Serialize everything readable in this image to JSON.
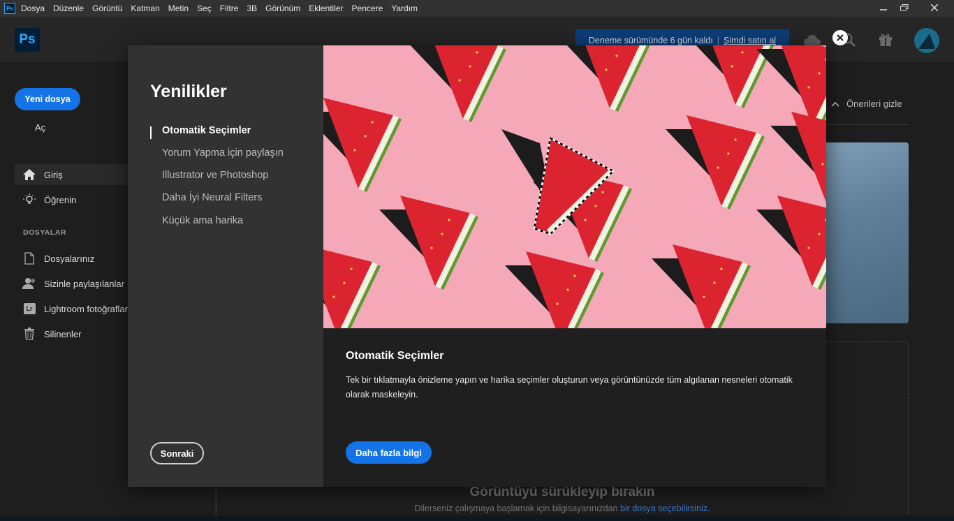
{
  "menubar": {
    "items": [
      "Dosya",
      "Düzenle",
      "Görüntü",
      "Katman",
      "Metin",
      "Seç",
      "Filtre",
      "3B",
      "Görünüm",
      "Eklentiler",
      "Pencere",
      "Yardım"
    ]
  },
  "header": {
    "logo": "Ps",
    "trial_text": "Deneme sürümünde 6 gün kaldı",
    "trial_separator": "|",
    "trial_buy": "Şimdi satın al"
  },
  "sidebar": {
    "new_file": "Yeni dosya",
    "open": "Aç",
    "home": "Giriş",
    "learn": "Öğrenin",
    "files_section": "DOSYALAR",
    "your_files": "Dosyalarınız",
    "shared": "Sizinle paylaşılanlar",
    "lightroom": "Lightroom fotoğrafları",
    "lightroom_badge": "Lr",
    "deleted": "Silinenler"
  },
  "main": {
    "hide_suggestions": "Önerileri gizle",
    "drop_title": "Görüntüyü sürükleyip bırakın",
    "drop_sub_prefix": "Dilerseniz çalışmaya başlamak için bilgisayarınızdan ",
    "drop_sub_link": "bir dosya seçebilirsiniz."
  },
  "modal": {
    "title": "Yenilikler",
    "topics": [
      "Otomatik Seçimler",
      "Yorum Yapma için paylaşın",
      "Illustrator ve Photoshop",
      "Daha İyi Neural Filters",
      "Küçük ama harika"
    ],
    "active_topic_index": 0,
    "next": "Sonraki",
    "detail_title": "Otomatik Seçimler",
    "detail_body": "Tek bir tıklatmayla önizleme yapın ve harika seçimler oluşturun veya görüntünüzde tüm algılanan nesneleri otomatik olarak maskeleyin.",
    "learn_more": "Daha fazla bilgi"
  },
  "colors": {
    "accent_blue": "#1473e6",
    "trial_bg": "#0d3e78",
    "image_bg": "#f4a8b8",
    "watermelon_red": "#e0262f"
  }
}
